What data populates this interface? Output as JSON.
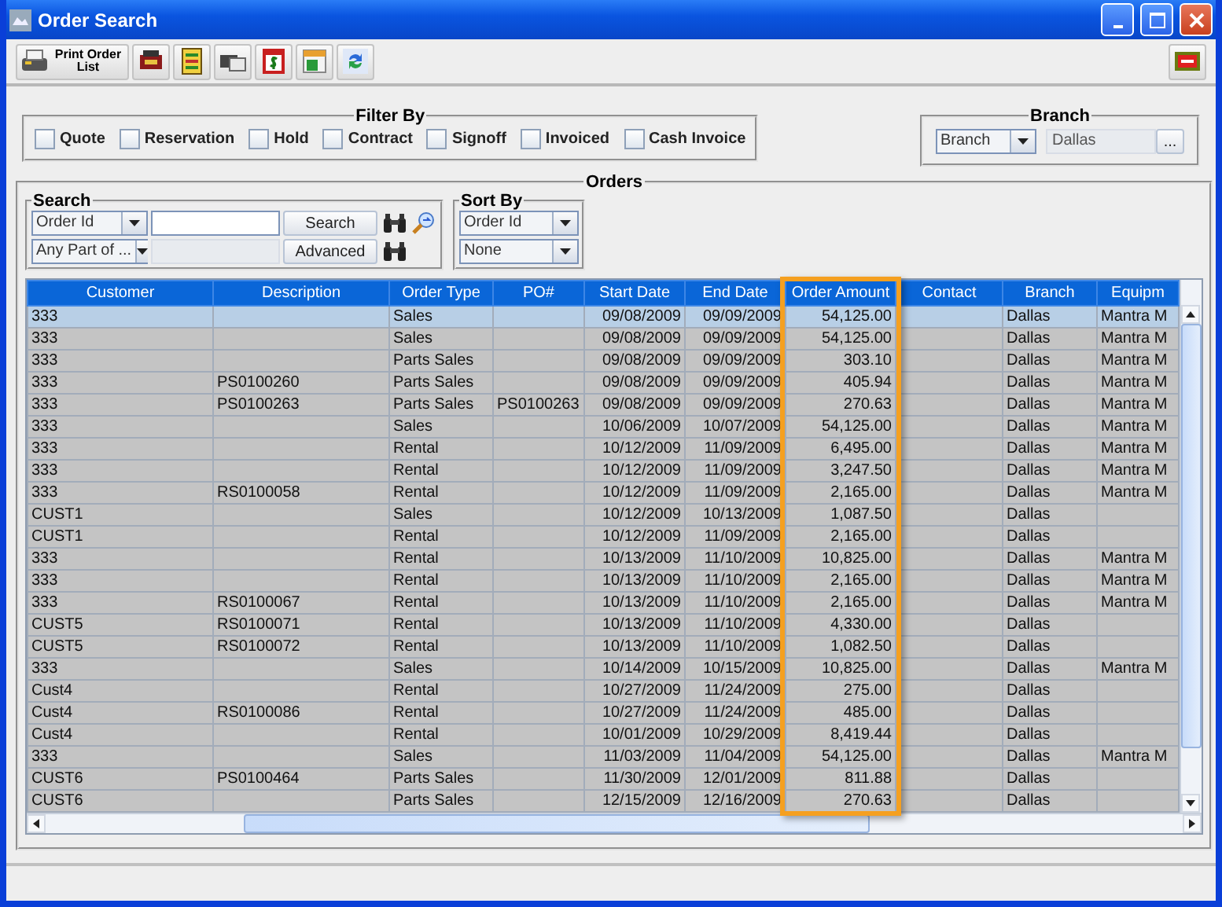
{
  "window": {
    "title": "Order Search"
  },
  "toolbar": {
    "print_button": "Print Order List"
  },
  "filter": {
    "title": "Filter By",
    "options": [
      {
        "label": "Quote",
        "checked": false
      },
      {
        "label": "Reservation",
        "checked": false
      },
      {
        "label": "Hold",
        "checked": false
      },
      {
        "label": "Contract",
        "checked": false
      },
      {
        "label": "Signoff",
        "checked": false
      },
      {
        "label": "Invoiced",
        "checked": false
      },
      {
        "label": "Cash Invoice",
        "checked": false
      }
    ]
  },
  "branch": {
    "title": "Branch",
    "type_select": "Branch",
    "value": "Dallas",
    "browse_button": "..."
  },
  "orders": {
    "title": "Orders",
    "search": {
      "title": "Search",
      "field_select": "Order Id",
      "match_select": "Any Part of ...",
      "search_button": "Search",
      "advanced_button": "Advanced"
    },
    "sort": {
      "title": "Sort By",
      "primary": "Order Id",
      "secondary": "None"
    },
    "table": {
      "columns": [
        {
          "label": "Customer",
          "highlighted": false
        },
        {
          "label": "Description",
          "highlighted": false
        },
        {
          "label": "Order Type",
          "highlighted": false
        },
        {
          "label": "PO#",
          "highlighted": false
        },
        {
          "label": "Start Date",
          "highlighted": false
        },
        {
          "label": "End Date",
          "highlighted": false
        },
        {
          "label": "Order Amount",
          "highlighted": true
        },
        {
          "label": "Contact",
          "highlighted": false
        },
        {
          "label": "Branch",
          "highlighted": false
        },
        {
          "label": "Equipm",
          "highlighted": false
        }
      ],
      "rows": [
        {
          "selected": true,
          "customer": "333",
          "order_type": "Sales",
          "start": "09/08/2009",
          "end": "09/09/2009",
          "amount": "54,125.00",
          "branch": "Dallas",
          "equipment": "Mantra M"
        },
        {
          "selected": false,
          "customer": "333",
          "order_type": "Sales",
          "start": "09/08/2009",
          "end": "09/09/2009",
          "amount": "54,125.00",
          "branch": "Dallas",
          "equipment": "Mantra M"
        },
        {
          "selected": false,
          "customer": "333",
          "order_type": "Parts Sales",
          "start": "09/08/2009",
          "end": "09/09/2009",
          "amount": "303.10",
          "branch": "Dallas",
          "equipment": "Mantra M"
        },
        {
          "selected": false,
          "customer": "333",
          "description": "PS0100260",
          "order_type": "Parts Sales",
          "start": "09/08/2009",
          "end": "09/09/2009",
          "amount": "405.94",
          "branch": "Dallas",
          "equipment": "Mantra M"
        },
        {
          "selected": false,
          "customer": "333",
          "description": "PS0100263",
          "order_type": "Parts Sales",
          "po": "PS0100263",
          "start": "09/08/2009",
          "end": "09/09/2009",
          "amount": "270.63",
          "branch": "Dallas",
          "equipment": "Mantra M"
        },
        {
          "selected": false,
          "customer": "333",
          "order_type": "Sales",
          "start": "10/06/2009",
          "end": "10/07/2009",
          "amount": "54,125.00",
          "branch": "Dallas",
          "equipment": "Mantra M"
        },
        {
          "selected": false,
          "customer": "333",
          "order_type": "Rental",
          "start": "10/12/2009",
          "end": "11/09/2009",
          "amount": "6,495.00",
          "branch": "Dallas",
          "equipment": "Mantra M"
        },
        {
          "selected": false,
          "customer": "333",
          "order_type": "Rental",
          "start": "10/12/2009",
          "end": "11/09/2009",
          "amount": "3,247.50",
          "branch": "Dallas",
          "equipment": "Mantra M"
        },
        {
          "selected": false,
          "customer": "333",
          "description": "RS0100058",
          "order_type": "Rental",
          "start": "10/12/2009",
          "end": "11/09/2009",
          "amount": "2,165.00",
          "branch": "Dallas",
          "equipment": "Mantra M"
        },
        {
          "selected": false,
          "customer": "CUST1",
          "order_type": "Sales",
          "start": "10/12/2009",
          "end": "10/13/2009",
          "amount": "1,087.50",
          "branch": "Dallas"
        },
        {
          "selected": false,
          "customer": "CUST1",
          "order_type": "Rental",
          "start": "10/12/2009",
          "end": "11/09/2009",
          "amount": "2,165.00",
          "branch": "Dallas"
        },
        {
          "selected": false,
          "customer": "333",
          "order_type": "Rental",
          "start": "10/13/2009",
          "end": "11/10/2009",
          "amount": "10,825.00",
          "branch": "Dallas",
          "equipment": "Mantra M"
        },
        {
          "selected": false,
          "customer": "333",
          "order_type": "Rental",
          "start": "10/13/2009",
          "end": "11/10/2009",
          "amount": "2,165.00",
          "branch": "Dallas",
          "equipment": "Mantra M"
        },
        {
          "selected": false,
          "customer": "333",
          "description": "RS0100067",
          "order_type": "Rental",
          "start": "10/13/2009",
          "end": "11/10/2009",
          "amount": "2,165.00",
          "branch": "Dallas",
          "equipment": "Mantra M"
        },
        {
          "selected": false,
          "customer": "CUST5",
          "description": "RS0100071",
          "order_type": "Rental",
          "start": "10/13/2009",
          "end": "11/10/2009",
          "amount": "4,330.00",
          "branch": "Dallas"
        },
        {
          "selected": false,
          "customer": "CUST5",
          "description": "RS0100072",
          "order_type": "Rental",
          "start": "10/13/2009",
          "end": "11/10/2009",
          "amount": "1,082.50",
          "branch": "Dallas"
        },
        {
          "selected": false,
          "customer": "333",
          "order_type": "Sales",
          "start": "10/14/2009",
          "end": "10/15/2009",
          "amount": "10,825.00",
          "branch": "Dallas",
          "equipment": "Mantra M"
        },
        {
          "selected": false,
          "customer": "Cust4",
          "order_type": "Rental",
          "start": "10/27/2009",
          "end": "11/24/2009",
          "amount": "275.00",
          "branch": "Dallas"
        },
        {
          "selected": false,
          "customer": "Cust4",
          "description": "RS0100086",
          "order_type": "Rental",
          "start": "10/27/2009",
          "end": "11/24/2009",
          "amount": "485.00",
          "branch": "Dallas"
        },
        {
          "selected": false,
          "customer": "Cust4",
          "order_type": "Rental",
          "start": "10/01/2009",
          "end": "10/29/2009",
          "amount": "8,419.44",
          "branch": "Dallas"
        },
        {
          "selected": false,
          "customer": "333",
          "order_type": "Sales",
          "start": "11/03/2009",
          "end": "11/04/2009",
          "amount": "54,125.00",
          "branch": "Dallas",
          "equipment": "Mantra M"
        },
        {
          "selected": false,
          "customer": "CUST6",
          "description": "PS0100464",
          "order_type": "Parts Sales",
          "start": "11/30/2009",
          "end": "12/01/2009",
          "amount": "811.88",
          "branch": "Dallas"
        },
        {
          "selected": false,
          "customer": "CUST6",
          "order_type": "Parts Sales",
          "start": "12/15/2009",
          "end": "12/16/2009",
          "amount": "270.63",
          "branch": "Dallas"
        }
      ]
    }
  }
}
